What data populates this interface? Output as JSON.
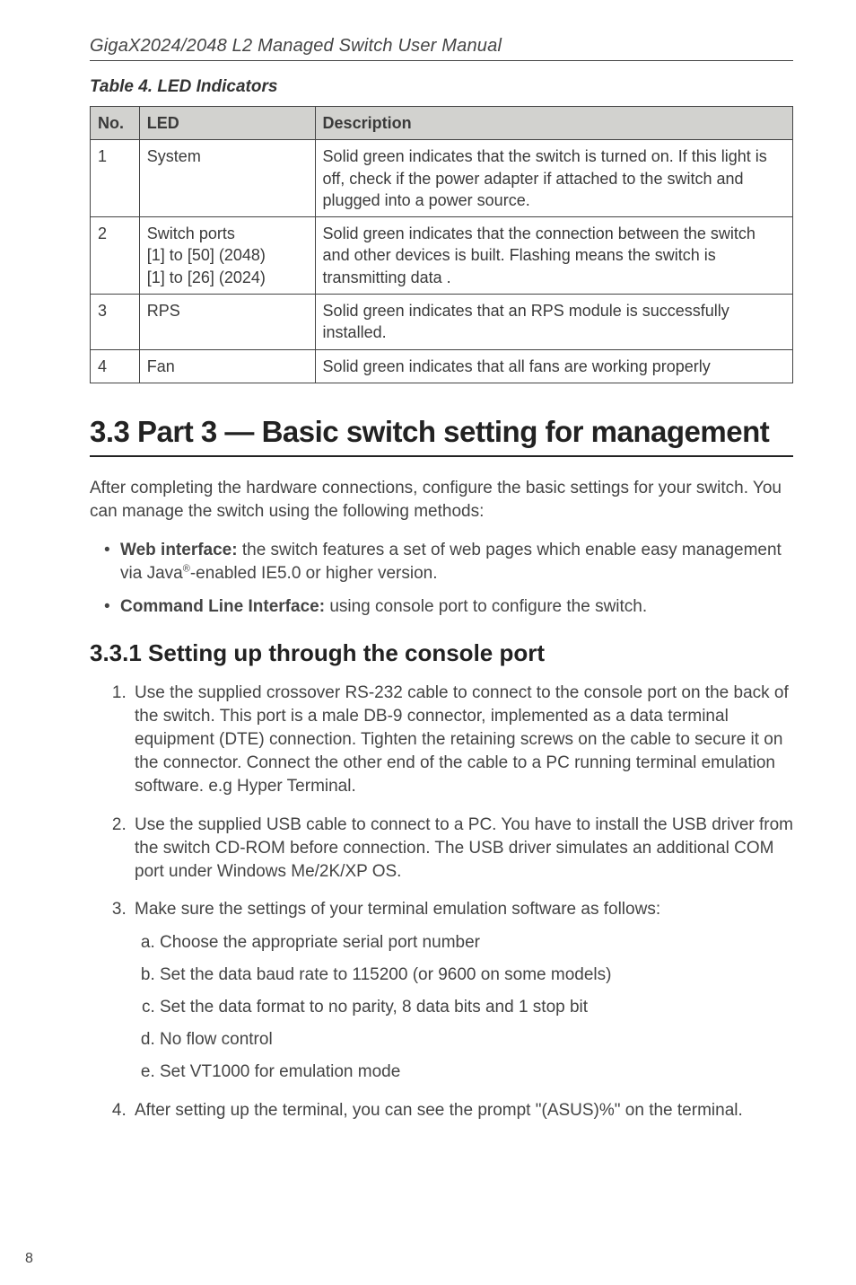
{
  "running_head": "GigaX2024/2048 L2 Managed Switch User Manual",
  "table_caption": "Table 4. LED Indicators",
  "table": {
    "headers": [
      "No.",
      "LED",
      "Description"
    ],
    "rows": [
      {
        "no": "1",
        "led": "System",
        "desc": "Solid green indicates that the switch is turned on. If this light is off, check if the power adapter if attached to the switch and plugged into a power source."
      },
      {
        "no": "2",
        "led": "Switch ports\n[1] to [50] (2048)\n[1] to [26] (2024)",
        "desc": "Solid green indicates that the connection between the switch and other devices is built. Flashing means the switch is transmitting data ."
      },
      {
        "no": "3",
        "led": "RPS",
        "desc": "Solid green indicates that an RPS module is successfully installed."
      },
      {
        "no": "4",
        "led": "Fan",
        "desc": "Solid green indicates that all fans are working properly"
      }
    ]
  },
  "h1": "3.3 Part 3 — Basic switch setting for management",
  "intro": "After completing the hardware connections, configure the basic settings for your switch. You can manage the switch using the following methods:",
  "bullet_web_bold": "Web interface:",
  "bullet_web_rest1": " the switch features a set of web pages which enable easy management via Java",
  "bullet_web_sup": "®",
  "bullet_web_rest2": "-enabled IE5.0 or higher version.",
  "bullet_cli_bold": "Command Line Interface:",
  "bullet_cli_rest": " using console port to configure the switch.",
  "h2": "3.3.1 Setting up through the console port",
  "steps": {
    "s1": "Use the supplied crossover RS-232 cable to connect to the console port on the back of the switch. This port is a male DB-9 connector, implemented as a data terminal equipment (DTE) connection. Tighten the retaining screws on the cable to secure it on the connector. Connect the other end of the cable to a PC running terminal emulation software. e.g Hyper Terminal.",
    "s2": "Use the supplied USB cable to connect to a PC. You have to install the USB driver from the switch CD-ROM before connection. The USB driver simulates an additional COM port under Windows Me/2K/XP OS.",
    "s3": "Make sure the settings of your terminal emulation software as follows:",
    "s3a": "Choose the appropriate serial port number",
    "s3b": "Set the data baud rate to 115200 (or 9600 on some models)",
    "s3c": "Set the data format to no parity, 8 data bits and 1 stop bit",
    "s3d": "No flow control",
    "s3e": "Set VT1000 for emulation mode",
    "s4": "After setting up the terminal, you can see the prompt \"(ASUS)%\" on the terminal."
  },
  "page_number": "8"
}
